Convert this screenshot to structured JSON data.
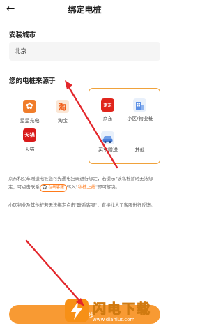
{
  "header": {
    "back_icon": "←",
    "title": "绑定电桩"
  },
  "install_city": {
    "label": "安装城市",
    "value": "北京"
  },
  "source": {
    "question": "您的电桩来源于"
  },
  "brands_left": [
    {
      "name": "星星充电",
      "icon": "star-charge-icon",
      "color": "#f07d2b",
      "glyph": "✿"
    },
    {
      "name": "淘宝",
      "icon": "taobao-icon",
      "color": "#f6e0cf",
      "glyph": "淘"
    },
    {
      "name": "天猫",
      "icon": "tmall-icon",
      "color": "#d91a1a",
      "glyph": "天猫"
    }
  ],
  "brands_right": [
    {
      "name": "京东",
      "icon": "jd-icon",
      "color": "#e0251c",
      "glyph": "京东"
    },
    {
      "name": "小区/物业桩",
      "icon": "community-icon",
      "color": "#e8f0fb",
      "glyph": "▮"
    },
    {
      "name": "买车赠送",
      "icon": "car-gift-icon",
      "color": "#e8f0fb",
      "glyph": "🚗"
    },
    {
      "name": "其他",
      "icon": "other-icon",
      "color": "#ffffff",
      "glyph": ""
    }
  ],
  "description": {
    "p1_part1": "京东和买车赠送电桩您可先通电扫码进行绑定，若提示\"该私桩暂时无法绑定，可点击联系",
    "service_tag": "在线客服",
    "p1_part2": "转入\"",
    "private_link": "私桩上线",
    "p1_part3": "\"即可解决。",
    "p2": "小区物业及其他桩若无法绑定点击\"联系客服\"，直接找人工客服进行反馈。"
  },
  "bottom_button": {
    "label": "下一步"
  },
  "watermark": {
    "text": "闪电下载",
    "url": "www.dianlut.com"
  }
}
